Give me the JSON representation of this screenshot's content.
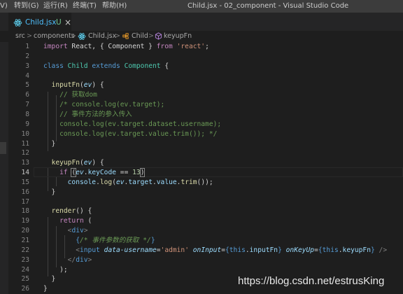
{
  "menubar": {
    "items": [
      "V)",
      "转到(G)",
      "运行(R)",
      "终端(T)",
      "帮助(H)"
    ],
    "window_title": "Child.jsx - 02_component - Visual Studio Code"
  },
  "tab": {
    "filename": "Child.jsx",
    "status": "U",
    "close": "×"
  },
  "breadcrumb": {
    "segments": [
      "src",
      "components",
      "Child.jsx",
      "Child",
      "keyupFn"
    ],
    "separator": ">"
  },
  "editor": {
    "active_line": 14,
    "lines": [
      {
        "n": "1",
        "t": [
          [
            "k1",
            "import"
          ],
          [
            "t",
            " React, { Component } "
          ],
          [
            "k1",
            "from"
          ],
          [
            "t",
            " "
          ],
          [
            "str",
            "'react'"
          ],
          [
            "t",
            ";"
          ]
        ]
      },
      {
        "n": "2",
        "t": []
      },
      {
        "n": "3",
        "t": [
          [
            "k2",
            "class"
          ],
          [
            "t",
            " "
          ],
          [
            "cls",
            "Child"
          ],
          [
            "t",
            " "
          ],
          [
            "k2",
            "extends"
          ],
          [
            "t",
            " "
          ],
          [
            "cls",
            "Component"
          ],
          [
            "t",
            " {"
          ]
        ]
      },
      {
        "n": "4",
        "t": []
      },
      {
        "n": "5",
        "t": [
          [
            "t",
            "  "
          ],
          [
            "fn",
            "inputFn"
          ],
          [
            "t",
            "("
          ],
          [
            "prm",
            "ev"
          ],
          [
            "t",
            ") {"
          ]
        ]
      },
      {
        "n": "6",
        "t": [
          [
            "t",
            "    "
          ],
          [
            "cm",
            "// 获取dom"
          ]
        ]
      },
      {
        "n": "7",
        "t": [
          [
            "t",
            "    "
          ],
          [
            "cm",
            "/* console.log(ev.target);"
          ]
        ]
      },
      {
        "n": "8",
        "t": [
          [
            "t",
            "    "
          ],
          [
            "cm",
            "// 事件方法的参入传入"
          ]
        ]
      },
      {
        "n": "9",
        "t": [
          [
            "t",
            "    "
          ],
          [
            "cm",
            "console.log(ev.target.dataset.username);"
          ]
        ]
      },
      {
        "n": "10",
        "t": [
          [
            "t",
            "    "
          ],
          [
            "cm",
            "console.log(ev.target.value.trim()); */"
          ]
        ]
      },
      {
        "n": "11",
        "t": [
          [
            "t",
            "  }"
          ]
        ]
      },
      {
        "n": "12",
        "t": []
      },
      {
        "n": "13",
        "t": [
          [
            "t",
            "  "
          ],
          [
            "fn",
            "keyupFn"
          ],
          [
            "t",
            "("
          ],
          [
            "prm",
            "ev"
          ],
          [
            "t",
            ") {"
          ]
        ]
      },
      {
        "n": "14",
        "t": [
          [
            "t",
            "    "
          ],
          [
            "k1",
            "if"
          ],
          [
            "t",
            " "
          ],
          [
            "bm",
            "("
          ],
          [
            "prm",
            "ev"
          ],
          [
            "t",
            "."
          ],
          [
            "var",
            "keyCode"
          ],
          [
            "t",
            " == "
          ],
          [
            "num",
            "13"
          ],
          [
            "bm",
            ")"
          ]
        ]
      },
      {
        "n": "15",
        "t": [
          [
            "t",
            "      "
          ],
          [
            "var",
            "console"
          ],
          [
            "t",
            "."
          ],
          [
            "fn",
            "log"
          ],
          [
            "t",
            "("
          ],
          [
            "prm",
            "ev"
          ],
          [
            "t",
            "."
          ],
          [
            "var",
            "target"
          ],
          [
            "t",
            "."
          ],
          [
            "var",
            "value"
          ],
          [
            "t",
            "."
          ],
          [
            "fn",
            "trim"
          ],
          [
            "t",
            "());"
          ]
        ]
      },
      {
        "n": "16",
        "t": [
          [
            "t",
            "  }"
          ]
        ]
      },
      {
        "n": "17",
        "t": []
      },
      {
        "n": "18",
        "t": [
          [
            "t",
            "  "
          ],
          [
            "fn",
            "render"
          ],
          [
            "t",
            "() {"
          ]
        ]
      },
      {
        "n": "19",
        "t": [
          [
            "t",
            "    "
          ],
          [
            "k1",
            "return"
          ],
          [
            "t",
            " ("
          ]
        ]
      },
      {
        "n": "20",
        "t": [
          [
            "t",
            "      "
          ],
          [
            "tagp",
            "<"
          ],
          [
            "tag",
            "div"
          ],
          [
            "tagp",
            ">"
          ]
        ]
      },
      {
        "n": "21",
        "t": [
          [
            "t",
            "        "
          ],
          [
            "k2",
            "{"
          ],
          [
            "cmi",
            "/* 事件参数的获取 */"
          ],
          [
            "k2",
            "}"
          ]
        ]
      },
      {
        "n": "22",
        "t": [
          [
            "t",
            "        "
          ],
          [
            "tagp",
            "<"
          ],
          [
            "tag",
            "input"
          ],
          [
            "t",
            " "
          ],
          [
            "attr",
            "data-username"
          ],
          [
            "t",
            "="
          ],
          [
            "str",
            "'admin'"
          ],
          [
            "t",
            " "
          ],
          [
            "attr",
            "onInput"
          ],
          [
            "t",
            "="
          ],
          [
            "k2",
            "{"
          ],
          [
            "k2",
            "this"
          ],
          [
            "t",
            "."
          ],
          [
            "var",
            "inputFn"
          ],
          [
            "k2",
            "}"
          ],
          [
            "t",
            " "
          ],
          [
            "attr",
            "onKeyUp"
          ],
          [
            "t",
            "="
          ],
          [
            "k2",
            "{"
          ],
          [
            "k2",
            "this"
          ],
          [
            "t",
            "."
          ],
          [
            "var",
            "keyupFn"
          ],
          [
            "k2",
            "}"
          ],
          [
            "t",
            " "
          ],
          [
            "tagp",
            "/>"
          ]
        ]
      },
      {
        "n": "23",
        "t": [
          [
            "t",
            "      "
          ],
          [
            "tagp",
            "</"
          ],
          [
            "tag",
            "div"
          ],
          [
            "tagp",
            ">"
          ]
        ]
      },
      {
        "n": "24",
        "t": [
          [
            "t",
            "    );"
          ]
        ]
      },
      {
        "n": "25",
        "t": [
          [
            "t",
            "  }"
          ]
        ]
      },
      {
        "n": "26",
        "t": [
          [
            "t",
            "}"
          ]
        ]
      }
    ]
  },
  "watermark": "https://blog.csdn.net/estrusKing",
  "colors": {
    "tab_filename": "#4fc1ff",
    "untracked_status": "#73c991",
    "react_icon": "#61dafb",
    "class_icon": "#ee9d28",
    "method_icon": "#b180d7"
  }
}
